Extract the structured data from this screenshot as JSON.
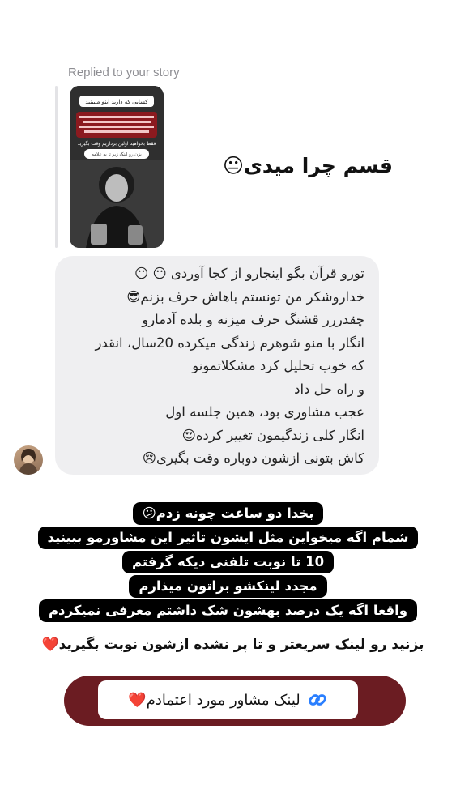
{
  "reply_header": {
    "text": "Replied to your story"
  },
  "story_preview": {
    "title": "کسایی که دارید اینو میبینید",
    "link_sticker": "بزن رو لینک زیر تا به علامه",
    "cta": "فقط بخواهید اولین برداریم وقت بگیرید"
  },
  "reaction": {
    "text": "قسم چرا میدی😐"
  },
  "message": {
    "lines": [
      "تورو قرآن بگو اینجارو از کجا آوردی 😐 😐",
      "خداروشکر من تونستم باهاش حرف بزنم😎",
      "چقدررر قشنگ حرف میزنه و بلده آدمارو",
      "انگار با منو شوهرم زندگی میکرده 20سال، انقدر",
      "که خوب تحلیل کرد مشکلاتمونو",
      "و راه حل داد",
      "عجب مشاوری بود، همین جلسه اول",
      "انگار کلی زندگیمون تغییر کرده😍",
      "کاش بتونی ازشون دوباره وقت بگیری😢"
    ]
  },
  "highlight_lines": [
    "بخدا دو ساعت چونه زدم😕",
    "شمام اگه میخواین مثل ایشون تاثیر این مشاورمو ببینید",
    "10 تا نوبت تلفنی دیکه گرفتم",
    "مجدد لینکشو براتون میذارم",
    "واقعا اگه یک درصد بهشون شک داشتم معرفی نمیکردم"
  ],
  "cta": {
    "text": "بزنید رو لینک سریعتر و تا پر نشده ازشون نوبت بگیرید❤️"
  },
  "link_sticker": {
    "label": "لینک مشاور مورد اعتمادم❤️",
    "icon": "link-icon"
  },
  "colors": {
    "sticker_bg": "#6b1c22",
    "bubble_bg": "#efeff1",
    "highlight_bg": "#000000"
  }
}
